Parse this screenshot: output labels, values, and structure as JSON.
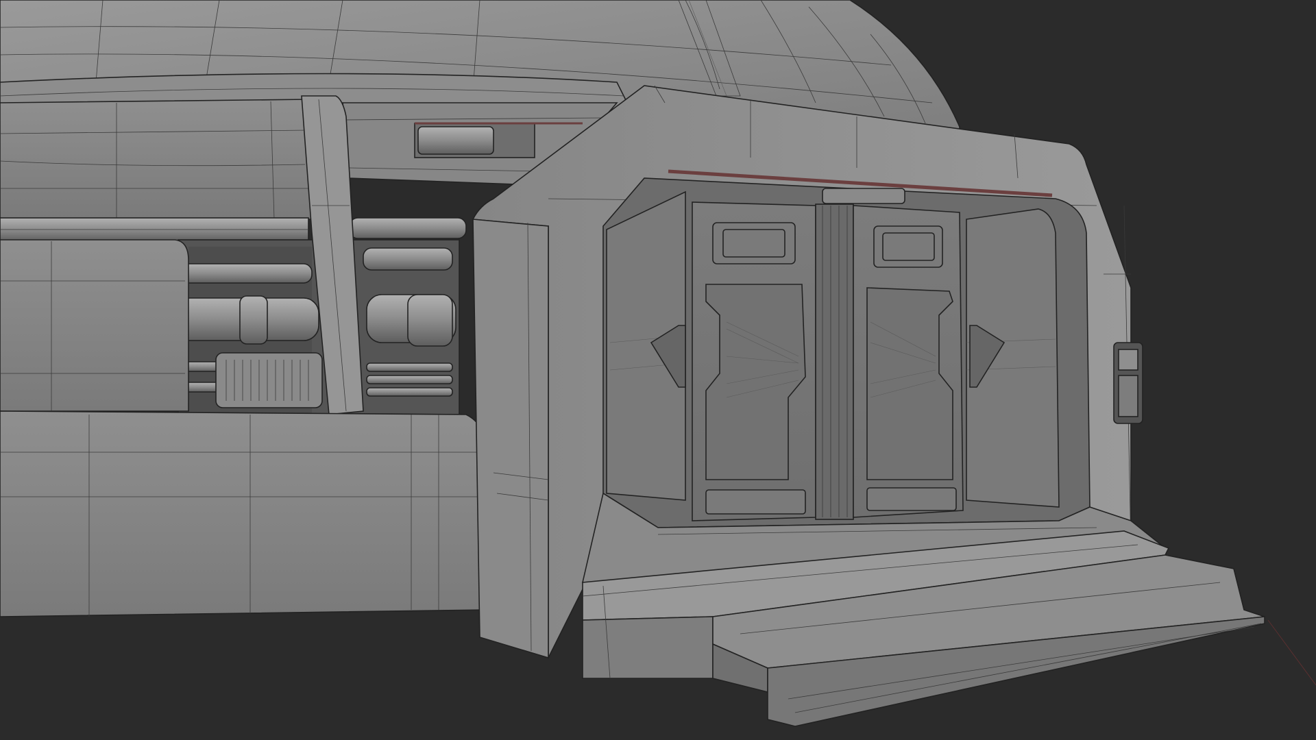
{
  "viewport": {
    "background_color": "#2b2b2b",
    "mesh_color": "#8e8e8e",
    "wire_color": "#3a3a3a"
  }
}
